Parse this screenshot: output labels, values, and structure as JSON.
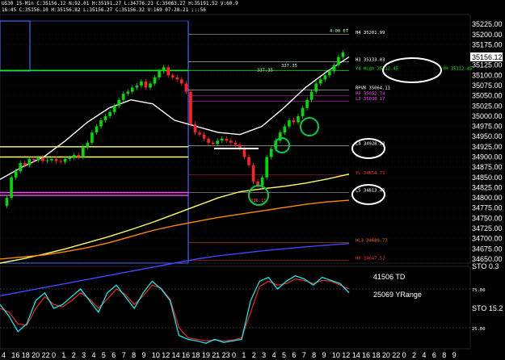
{
  "header": {
    "line1": "US30  15-Min  C:35156.12  N:92.01  H:35191.27  L:34776.21  C:35063.27  H:35191.52  V:60.9",
    "line2": "16:45  C:35156.10  H:35156.82  L:35156.27  C:35156.32  V:169  07-28-21  :::56"
  },
  "chart_data": {
    "type": "line",
    "price_axis": {
      "labels": [
        "35225.00",
        "35200.00",
        "35175.00",
        "35125.00",
        "35100.00",
        "35075.00",
        "35050.00",
        "35025.00",
        "35000.00",
        "34975.00",
        "34950.00",
        "34925.00",
        "34900.00",
        "34875.00",
        "34850.00",
        "34825.00",
        "34800.00",
        "34775.00",
        "34750.00",
        "34725.00",
        "34700.00",
        "34675.00",
        "34650.00"
      ],
      "values": [
        35225,
        35200,
        35175,
        35125,
        35100,
        35075,
        35050,
        35025,
        35000,
        34975,
        34950,
        34925,
        34900,
        34875,
        34850,
        34825,
        34800,
        34775,
        34750,
        34725,
        34700,
        34675,
        34650
      ],
      "current_price_label": "35156.12",
      "current_price": 35156.12,
      "ylim": [
        34640,
        35245
      ]
    },
    "time_axis": {
      "labels": [
        "4",
        "16",
        "18",
        "20",
        "22",
        "0",
        "1",
        "2",
        "3",
        "4",
        "5",
        "6",
        "7",
        "8",
        "9",
        "10",
        "12",
        "14",
        "16",
        "18",
        "19",
        "21",
        "23",
        "0",
        "1",
        "2",
        "3",
        "4",
        "5",
        "6",
        "7",
        "8",
        "9",
        "10",
        "12",
        "14",
        "16",
        "18",
        "20",
        "22",
        "0",
        "2",
        "4",
        "6",
        "8",
        "9"
      ]
    },
    "price_series": [
      34780,
      34800,
      34850,
      34865,
      34885,
      34880,
      34895,
      34892,
      34898,
      34890,
      34892,
      34895,
      34890,
      34888,
      34895,
      34898,
      34905,
      34900,
      34925,
      34935,
      34960,
      34975,
      34990,
      35000,
      35010,
      35025,
      35040,
      35055,
      35060,
      35070,
      35075,
      35085,
      35070,
      35080,
      35095,
      35110,
      35120,
      35100,
      35095,
      35090,
      35080,
      35060,
      34980,
      34960,
      34955,
      34945,
      34935,
      34932,
      34940,
      34945,
      34940,
      34935,
      34930,
      34920,
      34900,
      34880,
      34840,
      34830,
      34850,
      34900,
      34920,
      34940,
      34960,
      34975,
      34990,
      34985,
      35000,
      35020,
      35040,
      35060,
      35080,
      35090,
      35100,
      35110,
      35125,
      35145,
      35156
    ],
    "moving_averages": [
      {
        "color": "#ffff66",
        "values": [
          34640,
          34650,
          34662,
          34675,
          34690,
          34705,
          34722,
          34740,
          34760,
          34780,
          34800,
          34815,
          34822,
          34828,
          34836,
          34846,
          34858
        ]
      },
      {
        "color": "#ff8800",
        "values": [
          34650,
          34655,
          34660,
          34668,
          34678,
          34690,
          34705,
          34720,
          34732,
          34742,
          34752,
          34760,
          34768,
          34776,
          34784,
          34790,
          34794
        ]
      },
      {
        "color": "#ffffff",
        "values": [
          34845,
          34875,
          34900,
          34940,
          34985,
          35020,
          35040,
          35030,
          34990,
          34975,
          34960,
          34955,
          34975,
          35020,
          35070,
          35110,
          35145
        ]
      },
      {
        "color": "#4444ff",
        "values": [
          34560,
          34570,
          34580,
          34590,
          34600,
          34610,
          34620,
          34630,
          34640,
          34650,
          34658,
          34664,
          34670,
          34675,
          34680,
          34684,
          34688
        ]
      }
    ],
    "pivot_levels": [
      {
        "label": "H4  35201.99",
        "value": 35200,
        "color": "#ffffff"
      },
      {
        "label": "H3  35133.03",
        "value": 35133,
        "color": "#ffffff"
      },
      {
        "label": "Y4 High 35112.45",
        "value": 35112,
        "color": "#00ff00"
      },
      {
        "label": "YH  35112.45",
        "value": 35112,
        "color": "#00ff00"
      },
      {
        "label": "RPVR  35064.11",
        "value": 35064,
        "color": "#ffffff"
      },
      {
        "label": "PP  35052.74",
        "value": 35050,
        "color": "#ff44ff"
      },
      {
        "label": "L3  35038.17",
        "value": 35037,
        "color": "#ff44ff"
      },
      {
        "label": "L4  34928.23",
        "value": 34928,
        "color": "#ffffff"
      },
      {
        "label": "YL  34854.71",
        "value": 34856,
        "color": "#ff3333"
      },
      {
        "label": "L5  34813.42",
        "value": 34813,
        "color": "#ffffff"
      },
      {
        "label": "HL3  34689.73",
        "value": 34690,
        "color": "#ff6600"
      },
      {
        "label": "HP  34647.52",
        "value": 34647,
        "color": "#ff3333"
      }
    ],
    "annotations": [
      {
        "text": "4:00 ET",
        "value": 35205
      },
      {
        "text": "337.35",
        "value": 35120
      },
      {
        "text": "337.35",
        "value": 35110
      },
      {
        "text": "336.15",
        "value": 34790
      },
      {
        "text": "41506 TD",
        "color": "#ff8800"
      },
      {
        "text": "25069 YRange",
        "color": "#ffffff"
      }
    ],
    "stochastic": {
      "name": "STO",
      "label_top": "STO  0.3",
      "label_mid": "STO  15.2",
      "levels": [
        "25.00",
        "75.00"
      ],
      "k_values": [
        55,
        40,
        20,
        30,
        60,
        70,
        50,
        55,
        65,
        75,
        60,
        45,
        70,
        80,
        65,
        50,
        70,
        85,
        75,
        60,
        15,
        10,
        8,
        5,
        10,
        6,
        8,
        10,
        60,
        85,
        90,
        75,
        85,
        92,
        88,
        80,
        90,
        86,
        82,
        70
      ],
      "d_values": [
        50,
        45,
        30,
        28,
        50,
        65,
        55,
        52,
        60,
        70,
        62,
        50,
        62,
        75,
        68,
        55,
        66,
        80,
        76,
        62,
        25,
        12,
        10,
        8,
        9,
        8,
        9,
        12,
        45,
        78,
        85,
        80,
        82,
        88,
        86,
        82,
        86,
        85,
        80,
        75
      ]
    }
  },
  "colors": {
    "background": "#000000",
    "bull_candle": "#00dd00",
    "bear_candle": "#ff2222",
    "grid": "#333333",
    "stoch_k": "#00ffff",
    "stoch_d": "#ff2222"
  }
}
